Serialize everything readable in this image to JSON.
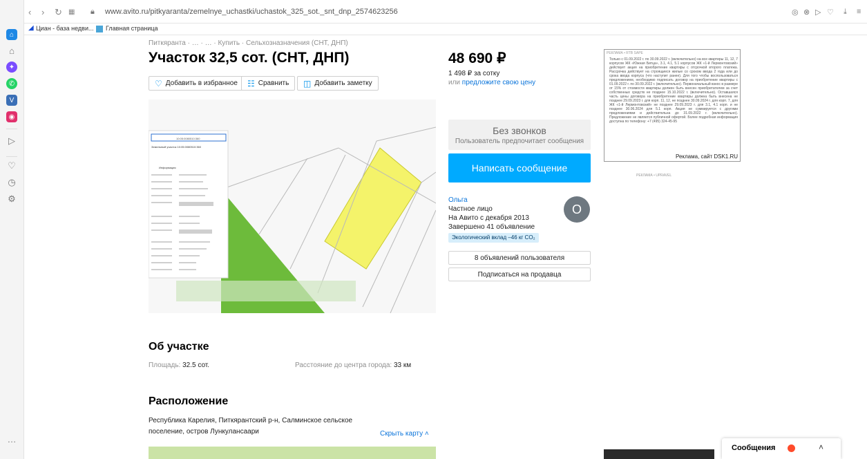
{
  "browser": {
    "url": "www.avito.ru/pitkyaranta/zemelnye_uchastki/uchastok_325_sot._snt_dnp_2574623256",
    "bookmarks": [
      "Циан - база недви...",
      "Главная страница"
    ]
  },
  "breadcrumb": "Питкяранта · … · … · Купить · Сельхозназначения (СНТ, ДНП)",
  "listing": {
    "title": "Участок 32,5 сот. (СНТ, ДНП)",
    "price": "48 690 ₽",
    "price_per_sotka": "1 498 ₽ за сотку",
    "offer_prefix": "или",
    "offer_link": "предложите свою цену"
  },
  "actions": {
    "favorite": "Добавить в избранное",
    "compare": "Сравнить",
    "note": "Добавить заметку"
  },
  "contact": {
    "no_calls_title": "Без звонков",
    "no_calls_sub": "Пользователь предпочитает сообщения",
    "write_button": "Написать сообщение"
  },
  "seller": {
    "name": "Ольга",
    "type": "Частное лицо",
    "since": "На Авито с декабря 2013",
    "completed": "Завершено 41 объявление",
    "eco": "Экологический вклад –46 кг CO₂",
    "avatar_letter": "О",
    "ads_button": "8 объявлений пользователя",
    "subscribe_button": "Подписаться на продавца"
  },
  "ad": {
    "label": "РЕКЛАМА • RTB SAPE",
    "text": "Только с 01.09.2022 г. по 30.09.2022 г. (включительно) на все квартиры 11, 12, 7 корпусов ЖК «Южная Битца», 3.1, 4.1, 5.1 корпусов ЖК «1-й Лермонтовский» действует акция на приобретение квартиры с отсрочкой второго платежа. Рассрочка действует на строящиеся жилые со сроком ввода 2 года или до срока ввода корпуса (что наступит ранее). Для того чтобы воспользоваться предложением, необходимо подписать договор на приобретение квартиры с 01.09.2022 г. по 30.09.2022 г. (включительно). Первоначальный взнос в размере от 15% от стоимости квартиры должен быть внесен приобретателем за счет собственных средств не позднее 15.10.2022 г. (включительно). Оставшаяся часть цены договора на приобретение квартиры должна быть внесена не позднее 29.09.2023 г. для корп. 11, 12, не позднее 30.09.2024 г. для корп. 7, для ЖК «1-й Лермонтовский» не позднее 29.09.2023 г. для 3.1, 4.1 корп. и не позднее 30.06.2024 для 5.1 корп. Акция не суммируется с другими предложениями и действительна до 31.09.2022 г. (включительно). Предложение не является публичной офертой. Более подробная информация доступна по телефону: +7 (495) 324-45-95",
    "signature": "Реклама, сайт DSK1.RU",
    "label2": "РЕКЛАМА • UPRAVEL"
  },
  "about": {
    "heading": "Об участке",
    "area_label": "Площадь:",
    "area_value": "32.5 сот.",
    "distance_label": "Расстояние до центра города:",
    "distance_value": "33 км"
  },
  "location": {
    "heading": "Расположение",
    "line1": "Республика Карелия, Питкярантский р-н, Салминское сельское",
    "line2": "поселение, остров Лункулансаари",
    "hide_map": "Скрыть карту"
  },
  "messages": {
    "label": "Сообщения"
  },
  "photo_inset": {
    "search_text": "10:05:0080510:360",
    "title": "Земельный участок 10:05:0080510:360",
    "tab": "Информация"
  }
}
